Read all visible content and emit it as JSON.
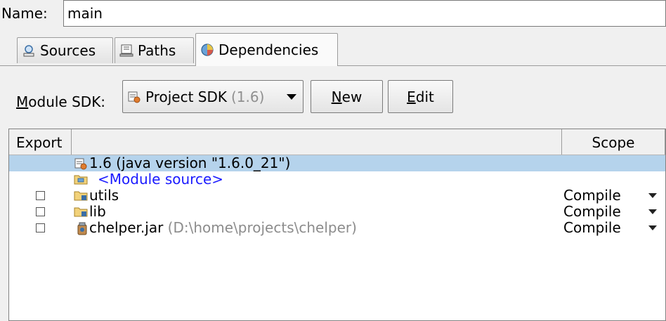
{
  "name_field": {
    "label": "Name:",
    "value": "main"
  },
  "tabs": [
    {
      "label": "Sources",
      "icon": "sources-icon"
    },
    {
      "label": "Paths",
      "icon": "paths-icon"
    },
    {
      "label": "Dependencies",
      "icon": "dependencies-icon",
      "active": true
    }
  ],
  "sdk": {
    "label": "Module SDK:",
    "selected": "Project SDK",
    "selected_version": "(1.6)",
    "new_label": "New",
    "edit_label": "Edit"
  },
  "table": {
    "columns": [
      "Export",
      "",
      "Scope"
    ],
    "rows": [
      {
        "name": "1.6 (java version \"1.6.0_21\")",
        "icon": "jdk-icon",
        "selected": true
      },
      {
        "name": "<Module source>",
        "icon": "module-source-folder-icon"
      },
      {
        "name": "utils",
        "icon": "module-folder-icon",
        "scope": "Compile",
        "exported": false
      },
      {
        "name": "lib",
        "icon": "module-folder-icon",
        "scope": "Compile",
        "exported": false
      },
      {
        "name": "chelper.jar",
        "path": "(D:\\home\\projects\\chelper)",
        "icon": "jar-icon",
        "scope": "Compile",
        "exported": false
      }
    ]
  },
  "colors": {
    "selection": "#b5d3ec",
    "link_blue": "#1a1aff",
    "panel_bg": "#f0f0f0"
  }
}
